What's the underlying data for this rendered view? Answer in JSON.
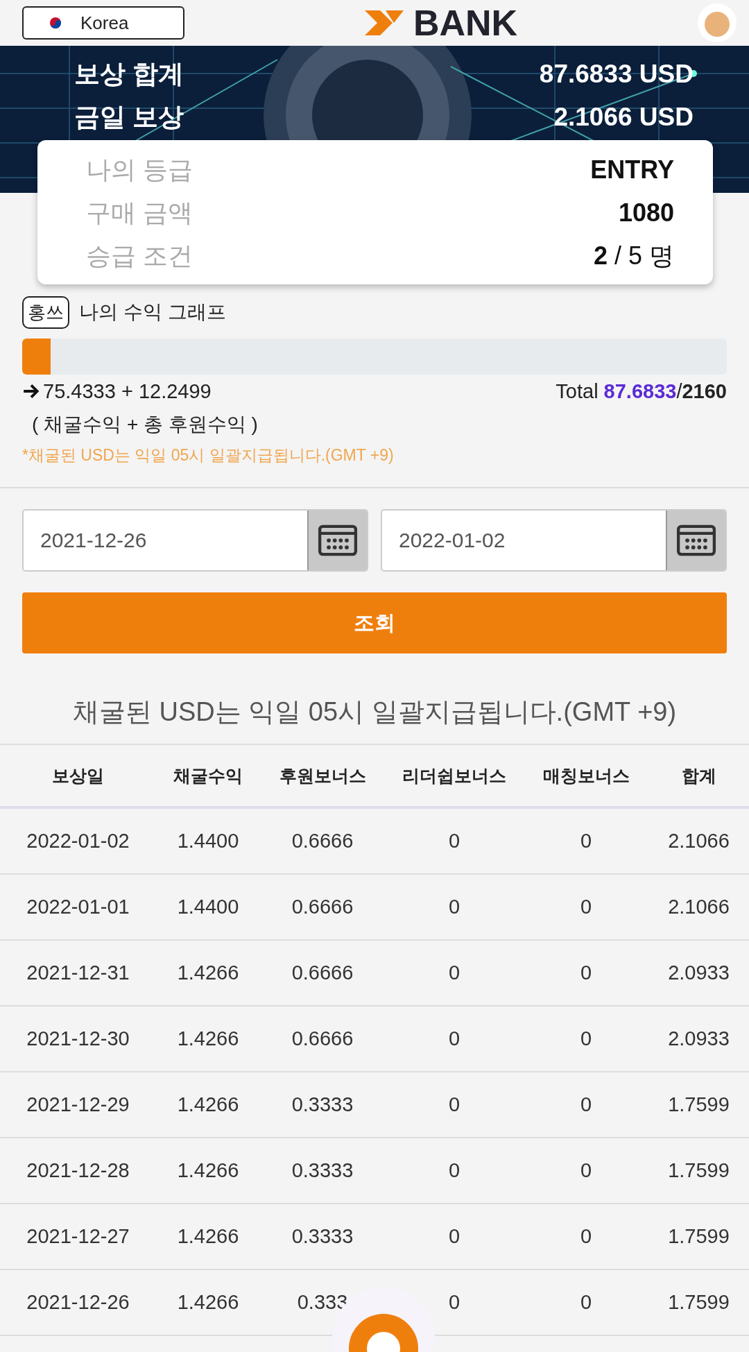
{
  "header": {
    "language": "Korea",
    "logo_text": "BANK"
  },
  "summary": [
    {
      "label": "보상 합계",
      "value": "87.6833 USD"
    },
    {
      "label": "금일 보상",
      "value": "2.1066 USD"
    }
  ],
  "grade_card": [
    {
      "label": "나의 등급",
      "value": "ENTRY"
    },
    {
      "label": "구매 금액",
      "value": "1080"
    },
    {
      "label": "승급 조건",
      "value": "**2** / 5 명"
    }
  ],
  "earnings": {
    "badge": "홍쓰",
    "title": "나의 수익 그래프",
    "level": 0.04,
    "formula": "75.4333 + 12.2499",
    "total_label": "Total",
    "total_value": "87.6833",
    "total_max": "/**2160**",
    "formula_legend": "( 채굴수익 + 총 후원수익 )",
    "note": "*채굴된 USD는 익일 05시 일괄지급됩니다.(GMT +9)"
  },
  "date_range": {
    "start": "2021-12-26",
    "end": "2022-01-02"
  },
  "search_button": "조회",
  "notice": "채굴된 USD는 익일 05시 일괄지급됩니다.(GMT +9)",
  "table": {
    "columns": [
      "보상일",
      "채굴수익",
      "후원보너스",
      "리더쉽보너스",
      "매칭보너스",
      "합계"
    ],
    "rows": [
      [
        "2022-01-02",
        "1.4400",
        "0.6666",
        "0",
        "0",
        "2.1066"
      ],
      [
        "2022-01-01",
        "1.4400",
        "0.6666",
        "0",
        "0",
        "2.1066"
      ],
      [
        "2021-12-31",
        "1.4266",
        "0.6666",
        "0",
        "0",
        "2.0933"
      ],
      [
        "2021-12-30",
        "1.4266",
        "0.6666",
        "0",
        "0",
        "2.0933"
      ],
      [
        "2021-12-29",
        "1.4266",
        "0.3333",
        "0",
        "0",
        "1.7599"
      ],
      [
        "2021-12-28",
        "1.4266",
        "0.3333",
        "0",
        "0",
        "1.7599"
      ],
      [
        "2021-12-27",
        "1.4266",
        "0.3333",
        "0",
        "0",
        "1.7599"
      ],
      [
        "2021-12-26",
        "1.4266",
        "0.333",
        "0",
        "0",
        "1.7599"
      ]
    ]
  }
}
